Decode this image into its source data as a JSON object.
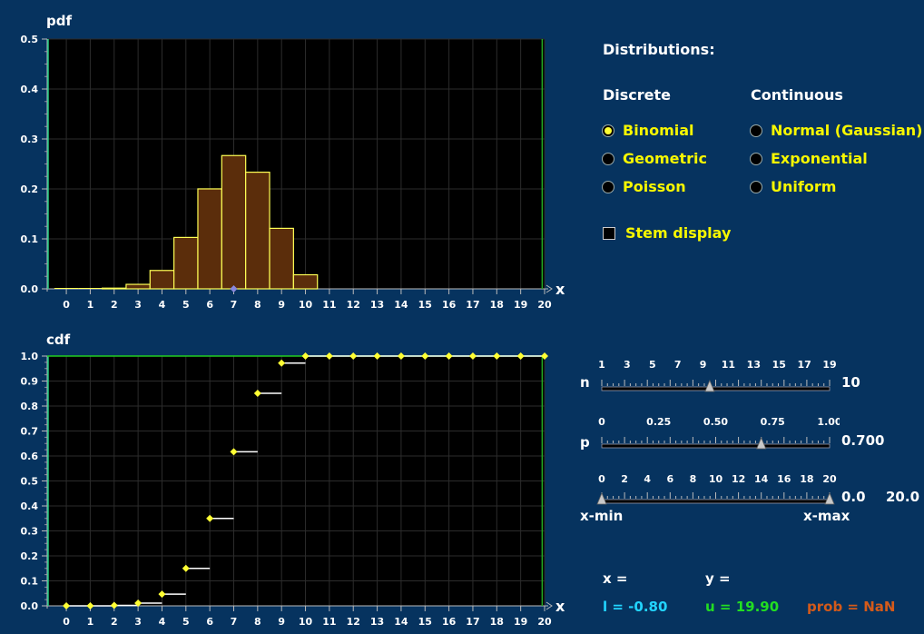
{
  "pdf_plot": {
    "title": "pdf",
    "xlabel": "x",
    "y_ticks": [
      "0.0",
      "0.1",
      "0.2",
      "0.3",
      "0.4",
      "0.5"
    ],
    "x_ticks": [
      "0",
      "1",
      "2",
      "3",
      "4",
      "5",
      "6",
      "7",
      "8",
      "9",
      "10",
      "11",
      "12",
      "13",
      "14",
      "15",
      "16",
      "17",
      "18",
      "19",
      "20"
    ]
  },
  "cdf_plot": {
    "title": "cdf",
    "xlabel": "x",
    "y_ticks": [
      "0.0",
      "0.1",
      "0.2",
      "0.3",
      "0.4",
      "0.5",
      "0.6",
      "0.7",
      "0.8",
      "0.9",
      "1.0"
    ],
    "x_ticks": [
      "0",
      "1",
      "2",
      "3",
      "4",
      "5",
      "6",
      "7",
      "8",
      "9",
      "10",
      "11",
      "12",
      "13",
      "14",
      "15",
      "16",
      "17",
      "18",
      "19",
      "20"
    ]
  },
  "chart_data": [
    {
      "type": "bar",
      "title": "pdf",
      "xlabel": "x",
      "ylabel": "",
      "x": [
        0,
        1,
        2,
        3,
        4,
        5,
        6,
        7,
        8,
        9,
        10
      ],
      "values": [
        0.0,
        0.0001,
        0.0014,
        0.009,
        0.0368,
        0.1029,
        0.2001,
        0.2668,
        0.2335,
        0.1211,
        0.0282
      ],
      "xlim": [
        -0.8,
        20
      ],
      "ylim": [
        0,
        0.5
      ],
      "marker_x": 7,
      "bar_color": "#5b2d0b",
      "edge_color": "#ffff55"
    },
    {
      "type": "line",
      "title": "cdf",
      "xlabel": "x",
      "ylabel": "",
      "x": [
        0,
        1,
        2,
        3,
        4,
        5,
        6,
        7,
        8,
        9,
        10,
        11,
        12,
        13,
        14,
        15,
        16,
        17,
        18,
        19,
        20
      ],
      "values": [
        0.0,
        0.0,
        0.002,
        0.011,
        0.047,
        0.15,
        0.35,
        0.617,
        0.851,
        0.972,
        1.0,
        1.0,
        1.0,
        1.0,
        1.0,
        1.0,
        1.0,
        1.0,
        1.0,
        1.0,
        1.0
      ],
      "xlim": [
        -0.8,
        20
      ],
      "ylim": [
        0,
        1.0
      ],
      "point_color": "#ffff33",
      "step_color": "#ffffff",
      "reference_line_y": 1.0
    }
  ],
  "distributions": {
    "title": "Distributions:",
    "discrete_header": "Discrete",
    "continuous_header": "Continuous",
    "discrete": [
      {
        "label": "Binomial",
        "selected": true
      },
      {
        "label": "Geometric",
        "selected": false
      },
      {
        "label": "Poisson",
        "selected": false
      }
    ],
    "continuous": [
      {
        "label": "Normal (Gaussian)",
        "selected": false
      },
      {
        "label": "Exponential",
        "selected": false
      },
      {
        "label": "Uniform",
        "selected": false
      }
    ],
    "stem_display": {
      "label": "Stem display",
      "checked": false
    }
  },
  "sliders": {
    "n": {
      "label": "n",
      "value": "10",
      "ticks": [
        "1",
        "3",
        "5",
        "7",
        "9",
        "11",
        "13",
        "15",
        "17",
        "19"
      ],
      "fraction": 0.4737
    },
    "p": {
      "label": "p",
      "value": "0.700",
      "ticks": [
        "0",
        "0.25",
        "0.50",
        "0.75",
        "1.00"
      ],
      "fraction": 0.7
    },
    "range": {
      "ticks": [
        "0",
        "2",
        "4",
        "6",
        "8",
        "10",
        "12",
        "14",
        "16",
        "18",
        "20"
      ],
      "min_label": "x-min",
      "max_label": "x-max",
      "min_value": "0.0",
      "max_value": "20.0",
      "min_fraction": 0.0,
      "max_fraction": 1.0
    }
  },
  "readout": {
    "x_label": "x =",
    "y_label": "y =",
    "l_text": "l = -0.80",
    "u_text": "u = 19.90",
    "prob_text": "prob = NaN"
  },
  "colors": {
    "background": "#06335f",
    "plot_bg": "#000000",
    "highlight": "#f7f700",
    "cyan": "#22d4ff",
    "green": "#22dd22",
    "orange": "#d45a1a"
  }
}
